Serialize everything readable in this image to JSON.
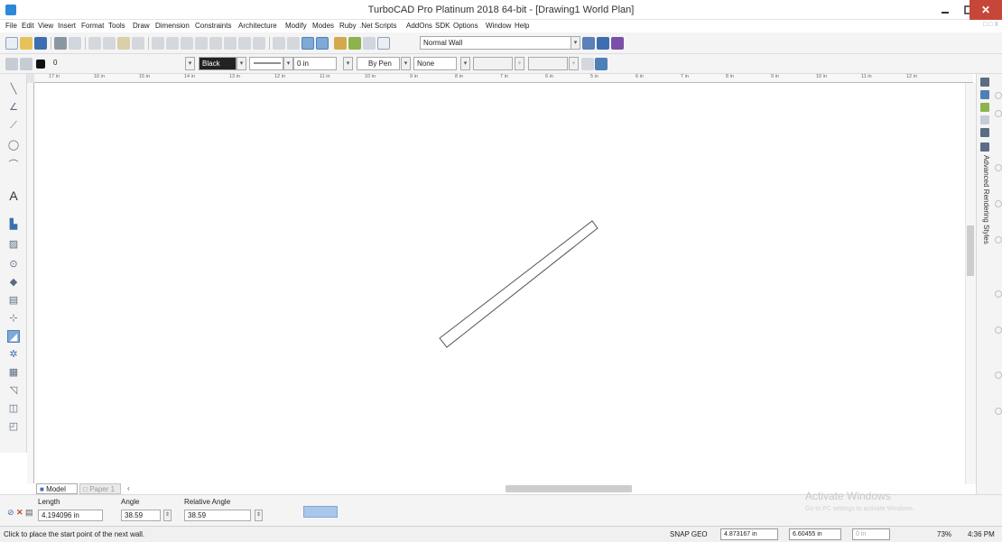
{
  "window": {
    "title": "TurboCAD Pro Platinum 2018 64-bit - [Drawing1 World Plan]",
    "min_icon": "minimize-icon",
    "max_icon": "maximize-icon",
    "close_glyph": "✕"
  },
  "menu": {
    "items": [
      "File",
      "Edit",
      "View",
      "Insert",
      "Format",
      "Tools",
      "Draw",
      "Dimension",
      "Constraints",
      "Architecture",
      "Modify",
      "Modes",
      "Ruby",
      ".Net Scripts",
      "AddOns",
      "SDK",
      "Options",
      "Window",
      "Help"
    ],
    "right_label": "□ □ X"
  },
  "toolbar": {
    "wall_style": "Normal Wall",
    "layer": "0",
    "color": "Black",
    "line_width": "0 in",
    "pen": "By Pen",
    "fill": "None"
  },
  "ruler": {
    "ticks": [
      "17 in",
      "16 in",
      "15 in",
      "14 in",
      "13 in",
      "12 in",
      "11 in",
      "10 in",
      "9 in",
      "8 in",
      "7 in",
      "6 in",
      "5 in",
      "6 in",
      "7 in",
      "8 in",
      "9 in",
      "10 in",
      "11 in",
      "12 in"
    ]
  },
  "right_panel": {
    "vertical_label": "Advanced Rendering Styles"
  },
  "tabs": {
    "model": "Model",
    "paper": "Paper 1",
    "scroll_left": "‹"
  },
  "inspector": {
    "length_label": "Length",
    "length_value": "4.194096 in",
    "angle_label": "Angle",
    "angle_value": "38.59",
    "relative_angle_label": "Relative Angle",
    "relative_angle_value": "38.59"
  },
  "watermark": {
    "title": "Activate Windows",
    "subtitle": "Go to PC settings to activate Windows."
  },
  "status": {
    "message": "Click to place the start point of the next wall.",
    "snap": "SNAP GEO",
    "x": "4.873167 in",
    "y": "6.60455 in",
    "z": "0 in",
    "zoom": "73%",
    "time": "4:36 PM"
  },
  "colors": {
    "accent": "#2d88d8",
    "close_button": "#c7463a",
    "canvas": "#ffffff"
  }
}
